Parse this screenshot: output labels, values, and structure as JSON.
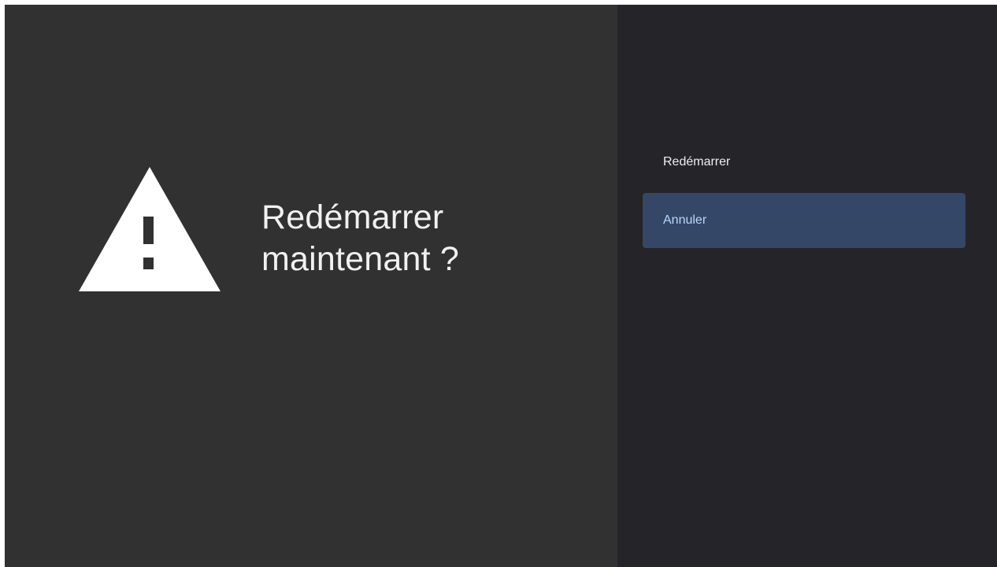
{
  "dialog": {
    "title": "Redémarrer\nmaintenant ?",
    "icon": "warning-icon"
  },
  "actions": [
    {
      "label": "Redémarrer",
      "focused": false
    },
    {
      "label": "Annuler",
      "focused": true
    }
  ],
  "colors": {
    "left_background": "#323132",
    "right_background": "#252428",
    "focus_background": "#344766",
    "focus_text": "#b9d7ff",
    "text": "#f1f1f1"
  }
}
